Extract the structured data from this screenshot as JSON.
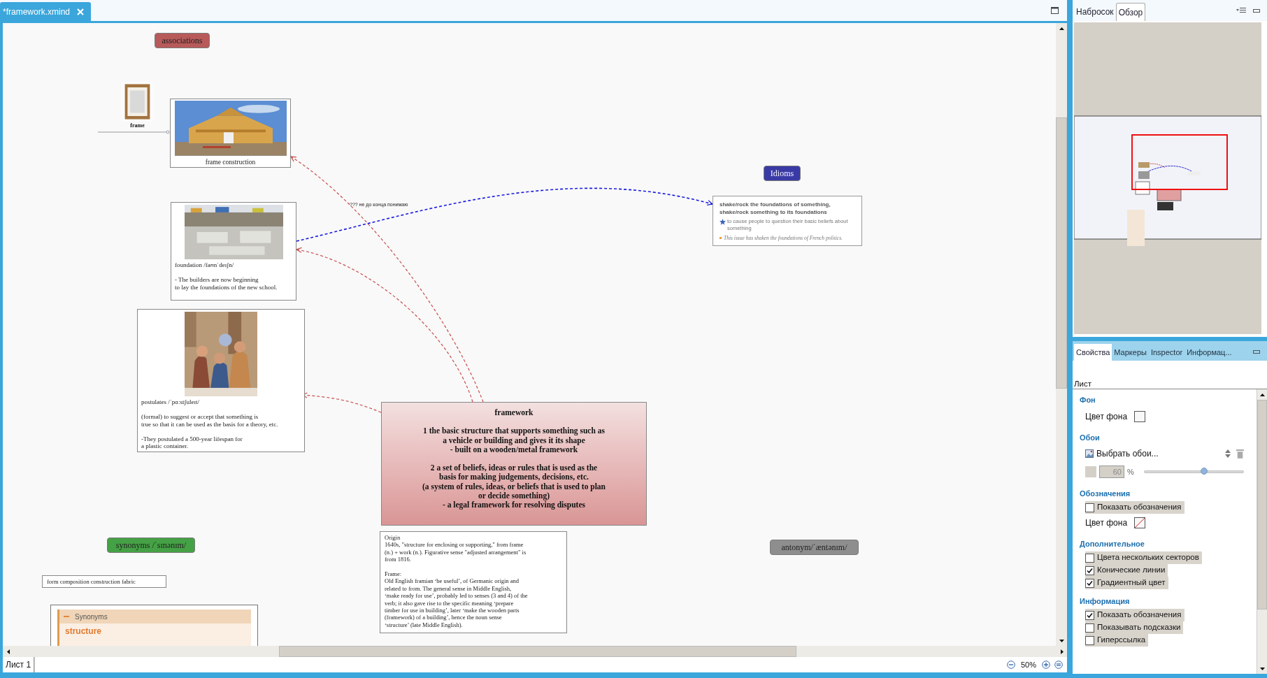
{
  "editor_tab": {
    "title": "*framework.xmind"
  },
  "map": {
    "nodes": [
      {
        "kind": "pill",
        "text": "associations",
        "color": "#b85a5a"
      },
      {
        "kind": "image_label",
        "text": "frame"
      },
      {
        "kind": "image_caption",
        "text": "frame construction"
      },
      {
        "kind": "pill",
        "text": "Idioms",
        "color": "#3a3aa6"
      },
      {
        "kind": "idiom_card",
        "title": "shake/rock the foundations of something, shake/rock something to its foundations",
        "definition": "to cause people to question their basic beliefs about something",
        "example": "This issue has shaken the foundations of French politics."
      },
      {
        "kind": "image_note",
        "text": "foundation /faʊnˈdeɪʃn/\n\n- The builders are now beginning\nto lay the foundations of the new school."
      },
      {
        "kind": "image_note",
        "text": "postulates /ˈpɑːstʃuleɪt/\n\n(formal) to suggest or accept that something is\ntrue so that it can be used as the basis for a theory, etc.\n\n-They postulated a 500-year lifespan for\na plastic container."
      },
      {
        "kind": "central",
        "text": "framework\n\n1 the basic structure that supports something such as\na vehicle or building and gives it its shape\n- built on a wooden/metal framework\n\n2 a set of beliefs, ideas or rules that is used as the\nbasis for making judgements, decisions, etc.\n(a system of rules, ideas, or beliefs that is used to plan\nor decide something)\n- a legal framework for resolving disputes"
      },
      {
        "kind": "pill",
        "text": "synonyms /ˈsɪnənɪm/",
        "color": "#45a145"
      },
      {
        "kind": "pill",
        "text": "antonym/ˈæntənɪm/",
        "color": "#8e8e8e"
      },
      {
        "kind": "plain",
        "text": "form composition construction fabric"
      },
      {
        "kind": "plain",
        "text": "Origin\n1640s, \"structure for enclosing or supporting,\" from frame\n(n.) + work (n.). Figurative sense \"adjusted arrangement\" is\nfrom 1816.\n\nFrame:\nOld English framian ‘be useful’, of Germanic origin and\nrelated to from. The general sense in Middle English,\n‘make ready for use’, probably led to senses (3 and 4) of the\nverb; it also gave rise to the specific meaning ‘prepare\ntimber for use in building’, later ‘make the wooden parts\n(framework) of a building’, hence the noun sense\n‘structure’ (late Middle English)."
      },
      {
        "kind": "synonym_panel",
        "header": "Synonyms",
        "entry": "structure"
      }
    ],
    "relationship_label": "??? не до конца понимаю"
  },
  "sheet_tabs": [
    {
      "label": "Лист 1",
      "selected": true
    }
  ],
  "zoom": "50%",
  "overview": {
    "tabs": [
      {
        "label": "Набросок",
        "selected": false
      },
      {
        "label": "Обзор",
        "selected": true
      }
    ]
  },
  "properties": {
    "tabs": [
      {
        "label": "Свойства",
        "selected": true
      },
      {
        "label": "Маркеры",
        "selected": false
      },
      {
        "label": "Inspector",
        "selected": false
      },
      {
        "label": "Информац...",
        "selected": false
      }
    ],
    "heading": "Лист",
    "sections": [
      {
        "title": "Фон",
        "rows": [
          {
            "kind": "color",
            "label": "Цвет фона",
            "cleared": false
          }
        ]
      },
      {
        "title": "Обои",
        "rows": [
          {
            "kind": "wallpaper",
            "label": "Выбрать обои..."
          },
          {
            "kind": "opacity",
            "value": "60",
            "unit": "%",
            "level": 0.6
          }
        ]
      },
      {
        "title": "Обозначения",
        "rows": [
          {
            "kind": "checkbox",
            "label": "Показать обозначения",
            "checked": false
          },
          {
            "kind": "color",
            "label": "Цвет фона",
            "cleared": true
          }
        ]
      },
      {
        "title": "Дополнительное",
        "rows": [
          {
            "kind": "checkbox",
            "label": "Цвета нескольких секторов",
            "checked": false
          },
          {
            "kind": "checkbox",
            "label": "Конические линии",
            "checked": true
          },
          {
            "kind": "checkbox",
            "label": "Градиентный цвет",
            "checked": true
          }
        ]
      },
      {
        "title": "Информация",
        "rows": [
          {
            "kind": "checkbox",
            "label": "Показать обозначения",
            "checked": true
          },
          {
            "kind": "checkbox",
            "label": "Показывать подсказки",
            "checked": false
          },
          {
            "kind": "checkbox",
            "label": "Гиперссылка",
            "checked": false
          }
        ]
      }
    ]
  }
}
